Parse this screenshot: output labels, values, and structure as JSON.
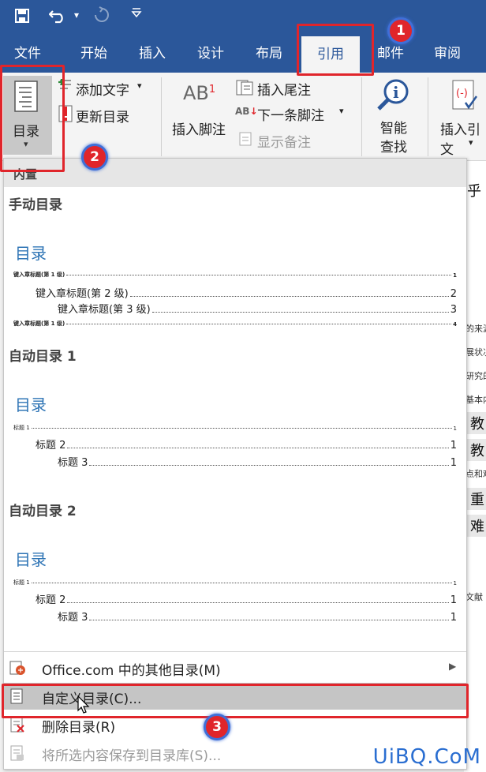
{
  "tabs": [
    "文件",
    "开始",
    "插入",
    "设计",
    "布局",
    "引用",
    "邮件",
    "审阅"
  ],
  "ribbon": {
    "toc_button": "目录",
    "add_text": "添加文字",
    "update_toc": "更新目录",
    "insert_footnote": "插入脚注",
    "insert_endnote": "插入尾注",
    "next_footnote": "下一条脚注",
    "show_notes": "显示备注",
    "smart_lookup_1": "智能",
    "smart_lookup_2": "查找",
    "insert_citation": "插入引文",
    "ab_label": "AB",
    "ab_sup": "1"
  },
  "badges": [
    "1",
    "2",
    "3"
  ],
  "panel": {
    "header": "内置",
    "manual": {
      "title": "手动目录",
      "toc_heading": "目录",
      "lines": [
        {
          "text": "键入章标题(第 1 级)",
          "page": "1"
        },
        {
          "text": "键入章标题(第 2 级)",
          "page": "2"
        },
        {
          "text": "键入章标题(第 3 级)",
          "page": "3"
        },
        {
          "text": "键入章标题(第 1 级)",
          "page": "4"
        }
      ]
    },
    "auto1": {
      "title": "自动目录 1",
      "toc_heading": "目录",
      "lines": [
        {
          "text": "标题 1",
          "page": "1"
        },
        {
          "text": "标题 2",
          "page": "1"
        },
        {
          "text": "标题 3",
          "page": "1"
        }
      ]
    },
    "auto2": {
      "title": "自动目录 2",
      "toc_heading": "目录",
      "lines": [
        {
          "text": "标题 1",
          "page": "1"
        },
        {
          "text": "标题 2",
          "page": "1"
        },
        {
          "text": "标题 3",
          "page": "1"
        }
      ]
    },
    "menu": {
      "office_more": "Office.com 中的其他目录(M)",
      "custom_toc": "自定义目录(C)...",
      "remove_toc": "删除目录(R)",
      "save_selection": "将所选内容保存到目录库(S)..."
    }
  },
  "doc_fragments": {
    "big_char": "乎",
    "bits": [
      "的来源",
      "展状况",
      "研究的",
      "基本内",
      "点和难",
      "文献"
    ],
    "boxes": [
      "教",
      "教",
      "重",
      "难"
    ]
  },
  "watermark": "UiBQ.CoM",
  "colors": {
    "accent": "#2b579a",
    "highlight": "#e0252b",
    "toc_blue": "#2e74b5"
  }
}
